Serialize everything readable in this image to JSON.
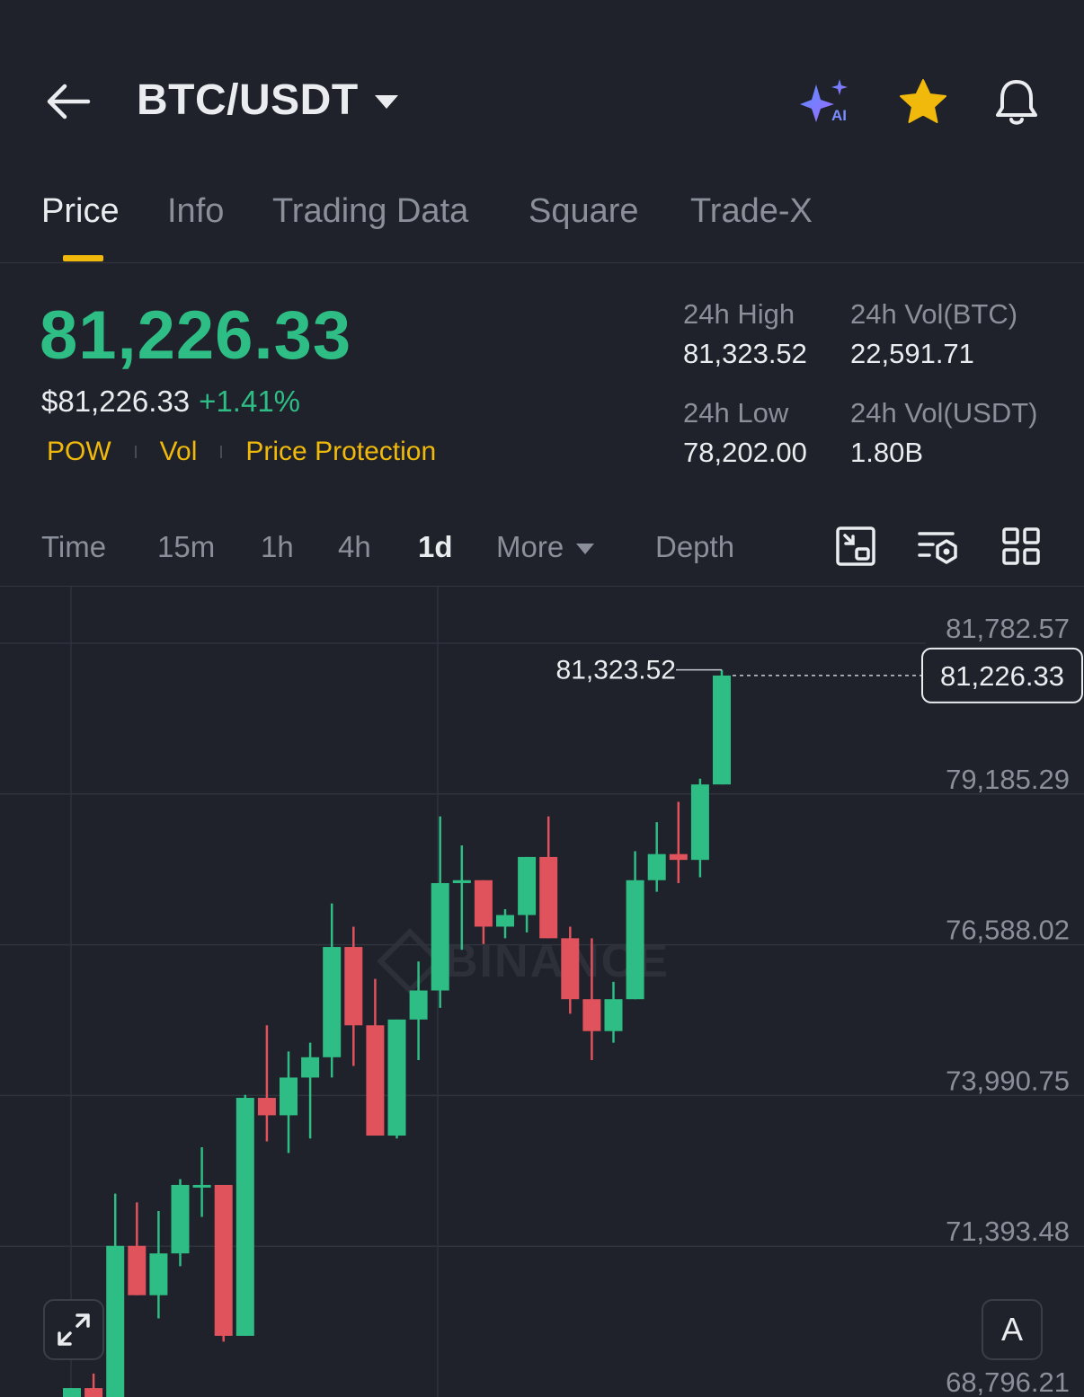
{
  "header": {
    "pair": "BTC/USDT",
    "icons": [
      "back-arrow-icon",
      "ai-sparkle-icon",
      "star-icon",
      "bell-icon"
    ],
    "ai_badge": "AI"
  },
  "tabs": [
    {
      "label": "Price",
      "active": true
    },
    {
      "label": "Info"
    },
    {
      "label": "Trading Data"
    },
    {
      "label": "Square"
    },
    {
      "label": "Trade-X"
    }
  ],
  "ticker": {
    "last_price": "81,226.33",
    "usd_price": "$81,226.33",
    "change": "+1.41%",
    "tags": [
      "POW",
      "Vol",
      "Price Protection"
    ],
    "stats": {
      "high_label": "24h High",
      "high": "81,323.52",
      "vol_btc_label": "24h Vol(BTC)",
      "vol_btc": "22,591.71",
      "low_label": "24h Low",
      "low": "78,202.00",
      "vol_usdt_label": "24h Vol(USDT)",
      "vol_usdt": "1.80B"
    }
  },
  "intervals": {
    "items": [
      "Time",
      "15m",
      "1h",
      "4h",
      "1d"
    ],
    "active": "1d",
    "more": "More",
    "depth": "Depth"
  },
  "colors": {
    "up": "#2ebd85",
    "down": "#e0525c",
    "accent": "#f0b90b",
    "bg": "#1f222a"
  },
  "watermark": "BINANCE",
  "auto_button": "A",
  "chart_data": {
    "type": "candlestick",
    "y_axis_labels": [
      "81,782.57",
      "79,185.29",
      "76,588.02",
      "73,990.75",
      "71,393.48",
      "68,796.21"
    ],
    "ylim": [
      68796.21,
      81782.57
    ],
    "last_price_label": "81,226.33",
    "high_marker_label": "81,323.52",
    "candles": [
      {
        "o": 68780,
        "h": 68950,
        "l": 68700,
        "c": 68950
      },
      {
        "o": 68950,
        "h": 69200,
        "l": 68700,
        "c": 68780
      },
      {
        "o": 68780,
        "h": 72300,
        "l": 68700,
        "c": 71400
      },
      {
        "o": 71400,
        "h": 72150,
        "l": 70900,
        "c": 70550
      },
      {
        "o": 70550,
        "h": 72000,
        "l": 70150,
        "c": 71270
      },
      {
        "o": 71270,
        "h": 72550,
        "l": 71050,
        "c": 72450
      },
      {
        "o": 72450,
        "h": 73100,
        "l": 71900,
        "c": 72450
      },
      {
        "o": 72450,
        "h": 71450,
        "l": 69750,
        "c": 69850
      },
      {
        "o": 69850,
        "h": 74000,
        "l": 69900,
        "c": 73950
      },
      {
        "o": 73950,
        "h": 75200,
        "l": 73200,
        "c": 73650
      },
      {
        "o": 73650,
        "h": 74750,
        "l": 73000,
        "c": 74300
      },
      {
        "o": 74300,
        "h": 74900,
        "l": 73250,
        "c": 74650
      },
      {
        "o": 74650,
        "h": 77300,
        "l": 74300,
        "c": 76550
      },
      {
        "o": 76550,
        "h": 76900,
        "l": 74500,
        "c": 75200
      },
      {
        "o": 75200,
        "h": 76000,
        "l": 73400,
        "c": 73300
      },
      {
        "o": 73300,
        "h": 75300,
        "l": 73250,
        "c": 75300
      },
      {
        "o": 75300,
        "h": 76300,
        "l": 74600,
        "c": 75800
      },
      {
        "o": 75800,
        "h": 78800,
        "l": 75500,
        "c": 77650
      },
      {
        "o": 77650,
        "h": 78300,
        "l": 76500,
        "c": 77700
      },
      {
        "o": 77700,
        "h": 77700,
        "l": 76600,
        "c": 76900
      },
      {
        "o": 76900,
        "h": 77200,
        "l": 76700,
        "c": 77100
      },
      {
        "o": 77100,
        "h": 78000,
        "l": 76800,
        "c": 78100
      },
      {
        "o": 78100,
        "h": 78800,
        "l": 76700,
        "c": 76700
      },
      {
        "o": 76700,
        "h": 76900,
        "l": 75400,
        "c": 75650
      },
      {
        "o": 75650,
        "h": 76700,
        "l": 74600,
        "c": 75100
      },
      {
        "o": 75100,
        "h": 75950,
        "l": 74900,
        "c": 75650
      },
      {
        "o": 75650,
        "h": 78200,
        "l": 75700,
        "c": 77700
      },
      {
        "o": 77700,
        "h": 78700,
        "l": 77500,
        "c": 78150
      },
      {
        "o": 78150,
        "h": 79050,
        "l": 77650,
        "c": 78050
      },
      {
        "o": 78050,
        "h": 79450,
        "l": 77750,
        "c": 79350
      },
      {
        "o": 79350,
        "h": 81323.52,
        "l": 79350,
        "c": 81226.33
      }
    ]
  }
}
